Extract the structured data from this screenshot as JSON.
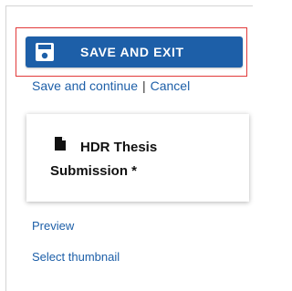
{
  "toolbar": {
    "save_exit_label": "SAVE AND EXIT",
    "save_continue_label": "Save and continue",
    "separator": "|",
    "cancel_label": "Cancel"
  },
  "card": {
    "title": "HDR Thesis Submission *"
  },
  "links": {
    "preview": "Preview",
    "select_thumbnail": "Select thumbnail"
  },
  "colors": {
    "primary": "#1d5fa8",
    "highlight": "#e23a3a"
  },
  "icons": {
    "save": "floppy-disk-icon",
    "document": "document-icon"
  }
}
